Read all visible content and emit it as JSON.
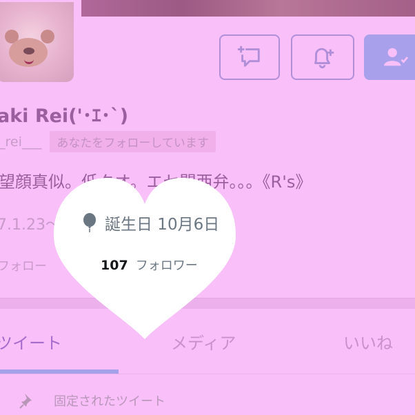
{
  "profile": {
    "name": "aki Rei('･ｴ･`)",
    "handle": "_rei___",
    "follows_you": "あなたをフォローしています",
    "bio": "望顔真似。低クオ。エセ関西弁。。。《R's》",
    "joined": "7.1.23〜",
    "birthday": "誕生日 10月6日",
    "following_label": "フォロー",
    "followers_count": "107",
    "followers_label": "フォロワー"
  },
  "tabs": [
    {
      "label": "ツイート"
    },
    {
      "label": "メディア"
    },
    {
      "label": "いいね"
    }
  ],
  "pinned_label": "固定されたツイート",
  "icons": {
    "dm": "add-message-icon",
    "notify": "bell-plus-icon",
    "following": "person-check-icon",
    "birthday": "balloon-icon",
    "pinned": "pin-icon"
  },
  "colors": {
    "background": "#f8bff8",
    "accent": "#a8a0ea",
    "heart": "#ffffff"
  }
}
